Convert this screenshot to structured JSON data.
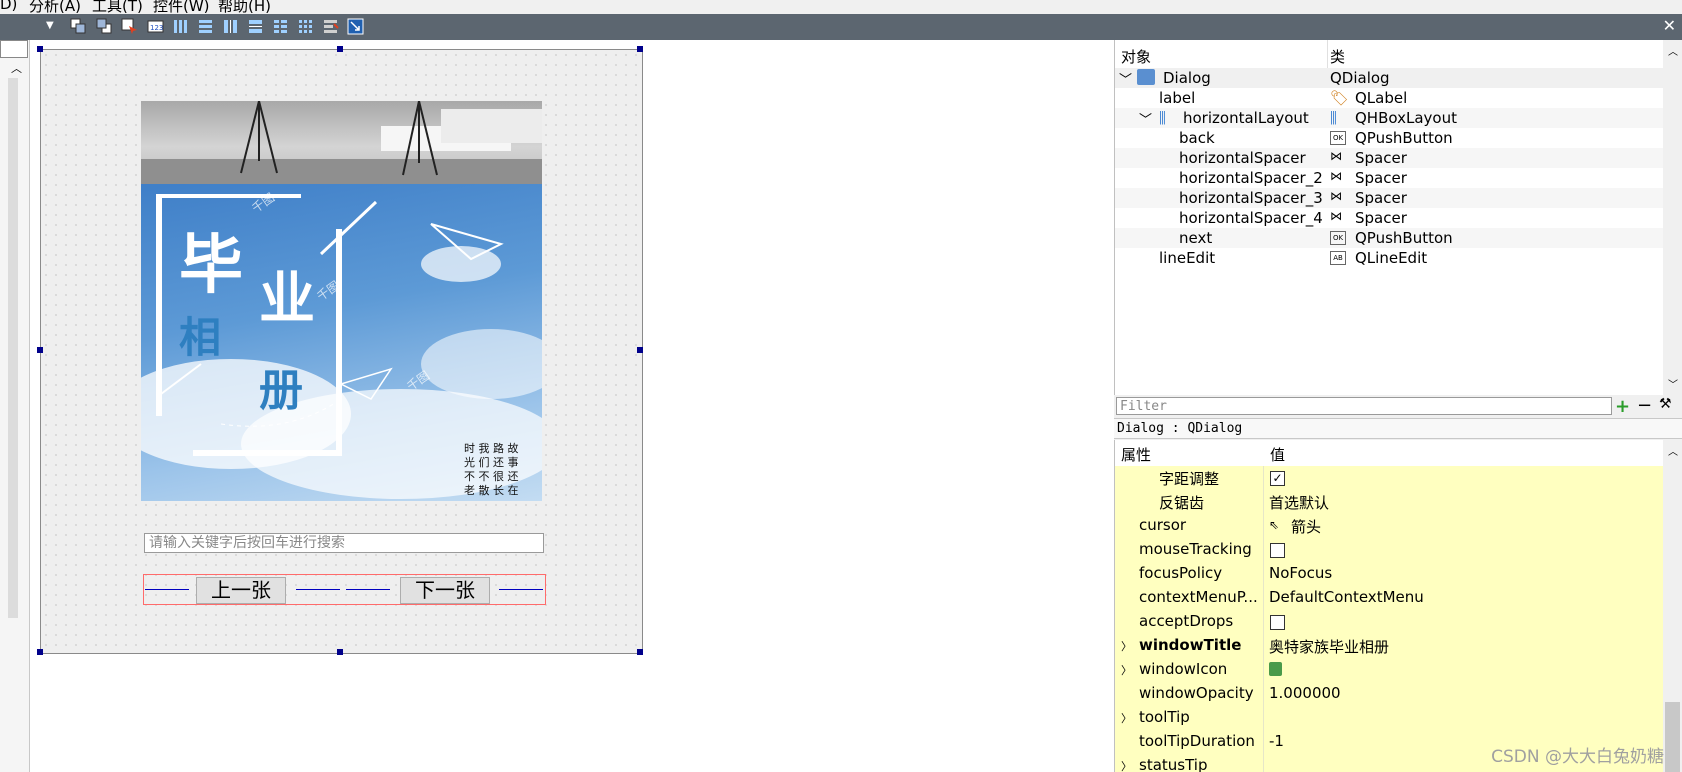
{
  "menu": {
    "prev_item": "D)",
    "analyze": "分析(A)",
    "tools": "工具(T)",
    "widgets": "控件(W)",
    "help": "帮助(H)"
  },
  "form": {
    "image": {
      "title_chars": [
        "毕",
        "业",
        "相",
        "册"
      ],
      "poem": "时 我 路 故\n光 们 还 事\n不 不 很 还\n老 散 长 在",
      "watermarks": [
        "千图",
        "千图",
        "千图"
      ]
    },
    "search_placeholder": "请输入关键字后按回车进行搜索",
    "prev_button": "上一张",
    "next_button": "下一张"
  },
  "object_inspector": {
    "col_object": "对象",
    "col_class": "类",
    "rows": [
      {
        "name": "Dialog",
        "class": "QDialog",
        "icon": "dialog-icon"
      },
      {
        "name": "label",
        "class": "QLabel",
        "icon": "label-icon"
      },
      {
        "name": "horizontalLayout",
        "class": "QHBoxLayout",
        "icon": "hbox-layout-icon"
      },
      {
        "name": "back",
        "class": "QPushButton",
        "icon": "pushbutton-icon"
      },
      {
        "name": "horizontalSpacer",
        "class": "Spacer",
        "icon": "spacer-icon"
      },
      {
        "name": "horizontalSpacer_2",
        "class": "Spacer",
        "icon": "spacer-icon"
      },
      {
        "name": "horizontalSpacer_3",
        "class": "Spacer",
        "icon": "spacer-icon"
      },
      {
        "name": "horizontalSpacer_4",
        "class": "Spacer",
        "icon": "spacer-icon"
      },
      {
        "name": "next",
        "class": "QPushButton",
        "icon": "pushbutton-icon"
      },
      {
        "name": "lineEdit",
        "class": "QLineEdit",
        "icon": "lineedit-icon"
      }
    ]
  },
  "property_editor": {
    "filter_placeholder": "Filter",
    "class_label": "Dialog : QDialog",
    "col_property": "属性",
    "col_value": "值",
    "rows": [
      {
        "name": "字距调整",
        "value": "",
        "checked": true
      },
      {
        "name": "反锯齿",
        "value": "首选默认"
      },
      {
        "name": "cursor",
        "value": "箭头"
      },
      {
        "name": "mouseTracking",
        "value": "",
        "checked": false
      },
      {
        "name": "focusPolicy",
        "value": "NoFocus"
      },
      {
        "name": "contextMenuP...",
        "value": "DefaultContextMenu"
      },
      {
        "name": "acceptDrops",
        "value": "",
        "checked": false
      },
      {
        "name": "windowTitle",
        "value": "奥特家族毕业相册",
        "bold": true
      },
      {
        "name": "windowIcon",
        "value": ""
      },
      {
        "name": "windowOpacity",
        "value": "1.000000"
      },
      {
        "name": "toolTip",
        "value": ""
      },
      {
        "name": "toolTipDuration",
        "value": "-1"
      },
      {
        "name": "statusTip",
        "value": ""
      }
    ]
  },
  "watermark": "CSDN @大大白兔奶糖",
  "colors": {
    "toolbar": "#5c6670",
    "property_row": "#ffffc0",
    "selection_handle": "#00008b",
    "spacer": "#0000c0"
  }
}
